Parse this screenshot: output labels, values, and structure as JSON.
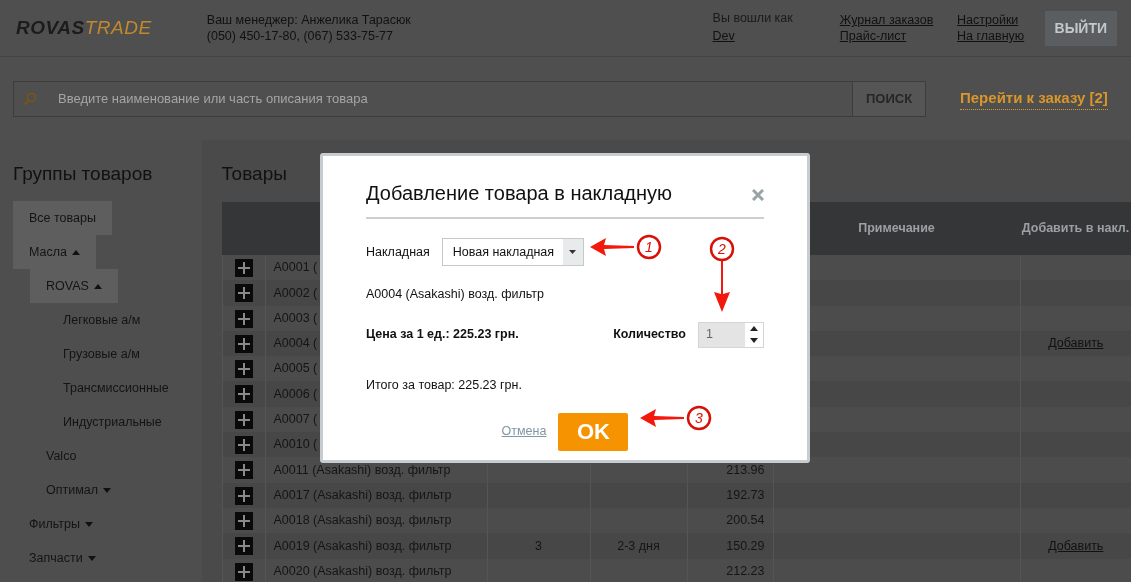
{
  "header": {
    "logo_left": "ROVAS",
    "logo_right": "TRADE",
    "manager": "Ваш менеджер: Анжелика Тарасюк",
    "phones": "(050) 450-17-80, (067) 533-75-77",
    "login_label": "Вы вошли как",
    "login_user": "Dev",
    "links": [
      "Журнал заказов",
      "Прайс-лист",
      "Настройки",
      "На главную"
    ],
    "logout": "ВЫЙТИ"
  },
  "search": {
    "placeholder": "Введите наименование или часть описания товара",
    "button": "ПОИСК",
    "order_link": "Перейти к заказу [2]"
  },
  "sidebar": {
    "title": "Группы товаров",
    "items": [
      {
        "label": "Все товары",
        "selected": true
      },
      {
        "label": "Масла",
        "selected": true,
        "expanded": true,
        "children": [
          {
            "label": "ROVAS",
            "selected": true,
            "expanded": true,
            "children": [
              {
                "label": "Легковые а/м",
                "selected": false
              },
              {
                "label": "Грузовые а/м",
                "selected": false
              },
              {
                "label": "Трансмиссионные",
                "selected": false
              },
              {
                "label": "Индустриальные",
                "selected": false
              }
            ]
          },
          {
            "label": "Valco",
            "selected": false
          },
          {
            "label": "Оптимал",
            "selected": false,
            "expanded": false
          }
        ]
      },
      {
        "label": "Фильтры",
        "selected": false,
        "expanded": false
      },
      {
        "label": "Запчасти",
        "selected": false,
        "expanded": false
      }
    ]
  },
  "table": {
    "title": "Товары",
    "columns": [
      "Примечание",
      "Добавить в накл."
    ],
    "rows": [
      {
        "name": "A0001 (",
        "stock": "",
        "delivery": "",
        "price": "",
        "add": ""
      },
      {
        "name": "A0002 (",
        "stock": "",
        "delivery": "",
        "price": "",
        "add": ""
      },
      {
        "name": "A0003 (",
        "stock": "",
        "delivery": "",
        "price": "",
        "add": ""
      },
      {
        "name": "A0004 (",
        "stock": "",
        "delivery": "",
        "price": "",
        "add": "Добавить"
      },
      {
        "name": "A0005 (",
        "stock": "",
        "delivery": "",
        "price": "",
        "add": ""
      },
      {
        "name": "A0006 (",
        "stock": "",
        "delivery": "",
        "price": "",
        "add": ""
      },
      {
        "name": "A0007 (",
        "stock": "",
        "delivery": "",
        "price": "",
        "add": ""
      },
      {
        "name": "A0010 (",
        "stock": "",
        "delivery": "",
        "price": "",
        "add": ""
      },
      {
        "name": "A0011 (Asakashi) возд. фильтр",
        "stock": "",
        "delivery": "",
        "price": "213.96",
        "add": ""
      },
      {
        "name": "A0017 (Asakashi) возд. фильтр",
        "stock": "",
        "delivery": "",
        "price": "192.73",
        "add": ""
      },
      {
        "name": "A0018 (Asakashi) возд. фильтр",
        "stock": "",
        "delivery": "",
        "price": "200.54",
        "add": ""
      },
      {
        "name": "A0019 (Asakashi) возд. фильтр",
        "stock": "3",
        "delivery": "2-3 дня",
        "price": "150.29",
        "add": "Добавить"
      },
      {
        "name": "A0020 (Asakashi) возд. фильтр",
        "stock": "",
        "delivery": "",
        "price": "212.23",
        "add": ""
      }
    ]
  },
  "dialog": {
    "title": "Добавление товара в накладную",
    "invoice_label": "Накладная",
    "invoice_value": "Новая накладная",
    "product": "A0004 (Asakashi) возд. фильтр",
    "price": "Цена за 1 ед.: 225.23 грн.",
    "quantity_label": "Количество",
    "quantity": "1",
    "total": "Итого за товар: 225.23 грн.",
    "cancel": "Отмена",
    "ok": "OK"
  },
  "callouts": [
    {
      "number": "1",
      "kind": "left"
    },
    {
      "number": "2",
      "kind": "down"
    },
    {
      "number": "3",
      "kind": "left"
    }
  ]
}
